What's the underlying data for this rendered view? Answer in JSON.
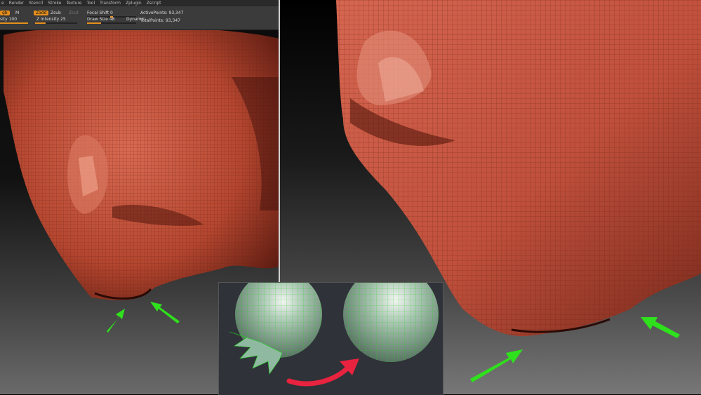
{
  "menu": {
    "items": [
      "e",
      "Render",
      "Stencil",
      "Stroke",
      "Texture",
      "Tool",
      "Transform",
      "Zplugin",
      "Zscript"
    ]
  },
  "toolbar": {
    "draw_label": "gb",
    "m_label": "M",
    "zadd_label": "Zadd",
    "zsub_label": "Zsub",
    "zcut_label": "Zcut",
    "intensity_label": "sity 100",
    "z_intensity_label": "Z Intensity 25",
    "focal_shift_label": "Focal Shift 0",
    "draw_size_label": "Draw Size 48",
    "dynamic_label": "Dynamic",
    "active_points_label": "ActivePoints: 93,347",
    "total_points_label": "TotalPoints: 93,347"
  },
  "colors": {
    "mesh": "#c0503c",
    "wire": "#6b2418",
    "arrow_green": "#2fe01c",
    "arrow_red": "#e8233f",
    "sphere": "#8fb9a0",
    "ui_accent": "#e8901c"
  },
  "icons": [
    "green-arrow-icon",
    "red-curved-arrow-icon"
  ]
}
